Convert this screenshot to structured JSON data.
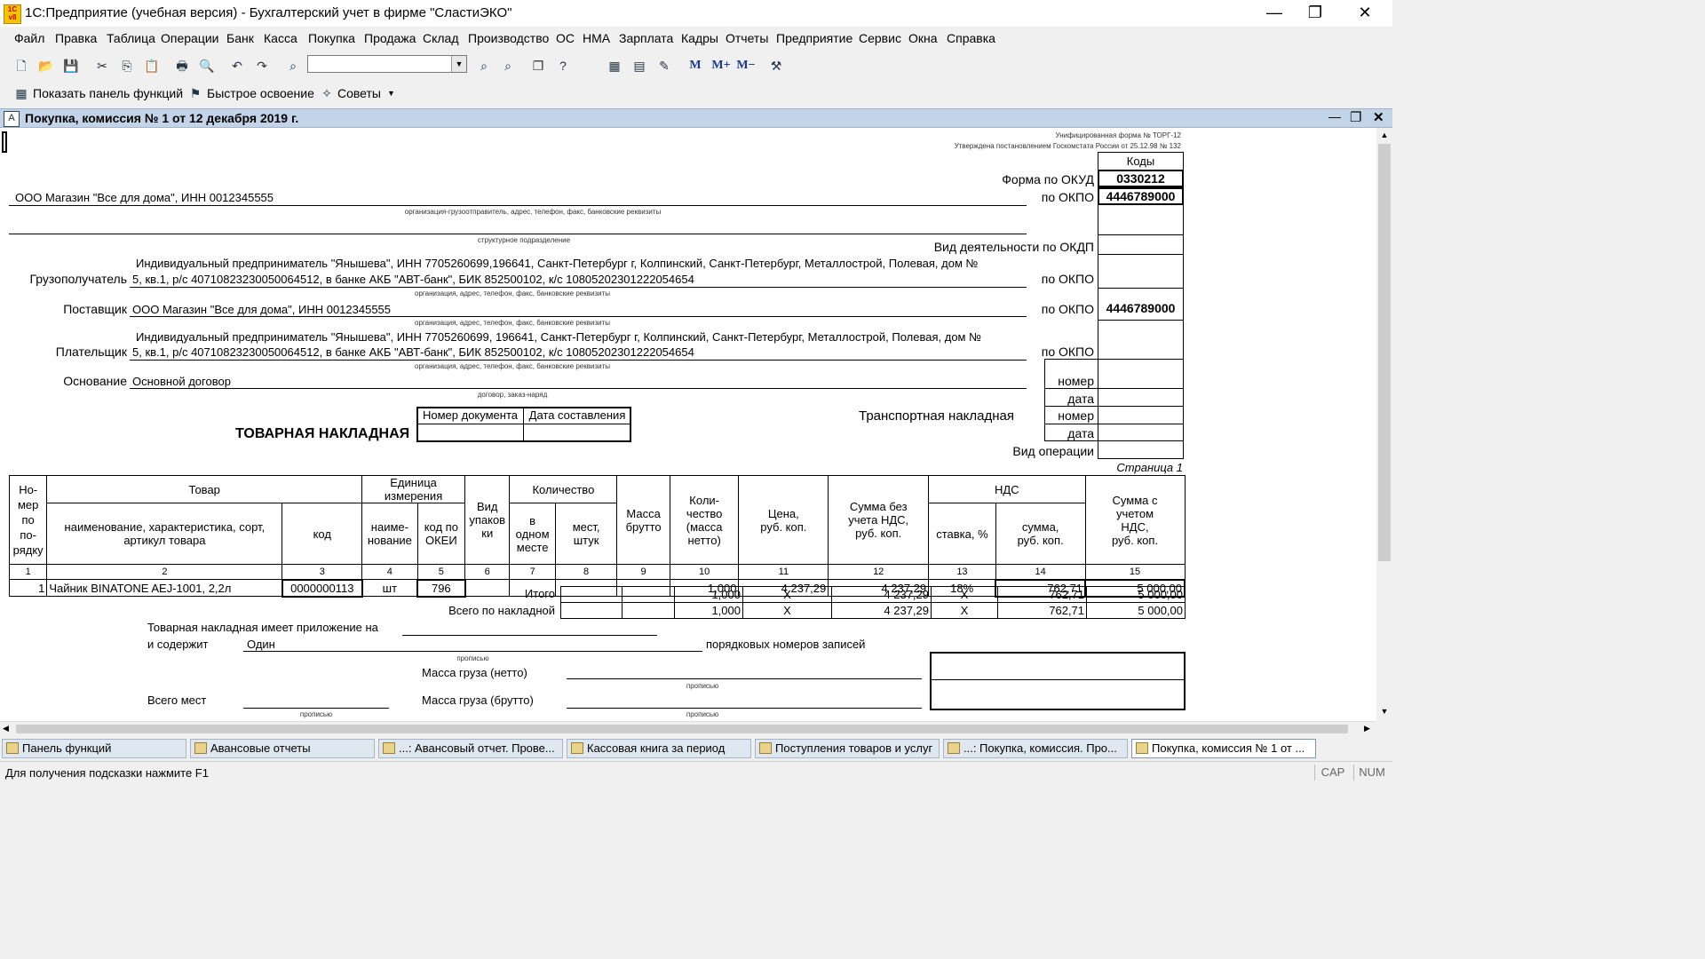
{
  "window": {
    "title": "1С:Предприятие (учебная версия) - Бухгалтерский учет в фирме \"СластиЭКО\"",
    "logo_text": "1С\nv8",
    "minimize": "—",
    "restore": "❐",
    "close": "✕"
  },
  "menu": [
    "Файл",
    "Правка",
    "Таблица",
    "Операции",
    "Банк",
    "Касса",
    "Покупка",
    "Продажа",
    "Склад",
    "Производство",
    "ОС",
    "НМА",
    "Зарплата",
    "Кадры",
    "Отчеты",
    "Предприятие",
    "Сервис",
    "Окна",
    "Справка"
  ],
  "toolbar2": {
    "functions_panel": "Показать панель функций",
    "quick_start": "Быстрое освоение",
    "tips": "Советы",
    "m_buttons": [
      "M",
      "M+",
      "M−"
    ]
  },
  "document_window": {
    "title": "Покупка, комиссия № 1 от 12 декабря 2019 г.",
    "minimize": "—",
    "restore": "❐",
    "close": "✕"
  },
  "form": {
    "unified_form": "Унифицированная форма № ТОРГ-12",
    "approved": "Утверждена постановлением Госкомстата России от 25.12.98 № 132",
    "codes_header": "Коды",
    "okud_label": "Форма по ОКУД",
    "okud_value": "0330212",
    "okpo_label": "по ОКПО",
    "okpo_value_1": "4446789000",
    "okpo_value_2": "4446789000",
    "okdp_label": "Вид деятельности по ОКДП",
    "shipper": "ООО Магазин \"Все для дома\", ИНН 0012345555",
    "shipper_caption": "организация-грузоотправитель, адрес, телефон, факс, банковские реквизиты",
    "division_caption": "структурное подразделение",
    "consignee_label": "Грузополучатель",
    "consignee_line1": "Индивидуальный предприниматель \"Янышева\", ИНН 7705260699,196641, Санкт-Петербург г, Колпинский, Санкт-Петербург, Металлострой, Полевая, дом №",
    "consignee_line2": "5, кв.1, р/с 40710823230050064512, в банке АКБ \"АВТ-банк\", БИК 852500102, к/с 10805202301222054654",
    "org_caption": "организация, адрес, телефон, факс, банковские реквизиты",
    "supplier_label": "Поставщик",
    "supplier": "ООО Магазин \"Все для дома\", ИНН 0012345555",
    "payer_label": "Плательщик",
    "payer_line1": "Индивидуальный предприниматель \"Янышева\", ИНН 7705260699, 196641, Санкт-Петербург г, Колпинский, Санкт-Петербург, Металлострой, Полевая, дом №",
    "payer_line2": "5, кв.1, р/с 40710823230050064512, в банке АКБ \"АВТ-банк\", БИК 852500102, к/с 10805202301222054654",
    "basis_label": "Основание",
    "basis": "Основной договор",
    "basis_caption": "договор, заказ-наряд",
    "number_label": "номер",
    "date_label": "дата",
    "transport_label": "Транспортная накладная",
    "operation_label": "Вид операции",
    "doc_number_header": "Номер документа",
    "doc_date_header": "Дата составления",
    "doc_name": "ТОВАРНАЯ НАКЛАДНАЯ",
    "page_label": "Страница 1"
  },
  "table": {
    "h_num": "Но-\nмер\nпо\nпо-\nрядку",
    "h_goods": "Товар",
    "h_goods_name": "наименование, характеристика, сорт, артикул товара",
    "h_code": "код",
    "h_unit": "Единица измерения",
    "h_unit_name": "наиме-\nнование",
    "h_okei": "код по\nОКЕИ",
    "h_pack": "Вид\nупаков\nки",
    "h_qty": "Количество",
    "h_qty_one": "в\nодном\nместе",
    "h_places": "мест,\nштук",
    "h_gross": "Масса\nбрутто",
    "h_net": "Коли-\nчество\n(масса\nнетто)",
    "h_price": "Цена,\nруб. коп.",
    "h_sum_novat": "Сумма без\nучета НДС,\nруб. коп.",
    "h_vat": "НДС",
    "h_vat_rate": "ставка, %",
    "h_vat_sum": "сумма,\nруб. коп.",
    "h_sum_vat": "Сумма с\nучетом\nНДС,\nруб. коп.",
    "col_numbers": [
      "1",
      "2",
      "3",
      "4",
      "5",
      "6",
      "7",
      "8",
      "9",
      "10",
      "11",
      "12",
      "13",
      "14",
      "15"
    ],
    "rows": [
      {
        "num": "1",
        "name": "Чайник BINATONE  AEJ-1001,  2,2л",
        "code": "0000000113",
        "unit": "шт",
        "okei": "796",
        "pack": "",
        "qty_one": "",
        "places": "",
        "gross": "",
        "net": "1,000",
        "price": "4 237,29",
        "sum": "4 237,29",
        "rate": "18%",
        "vat": "762,71",
        "total": "5 000,00"
      }
    ],
    "itogo_label": "Итого",
    "itogo": {
      "net": "1,000",
      "price": "X",
      "sum": "4 237,29",
      "rate": "X",
      "vat": "762,71",
      "total": "5 000,00"
    },
    "vsego_label": "Всего по накладной",
    "vsego": {
      "net": "1,000",
      "price": "X",
      "sum": "4 237,29",
      "rate": "X",
      "vat": "762,71",
      "total": "5 000,00"
    }
  },
  "footer": {
    "attachment_label": "Товарная накладная имеет приложение на",
    "contains_label": "и содержит",
    "contains_value": "Один",
    "records_label": "порядковых номеров записей",
    "in_words": "прописью",
    "net_mass_label": "Масса груза (нетто)",
    "places_label": "Всего мест",
    "gross_mass_label": "Масса груза (брутто)"
  },
  "taskbar": [
    "Панель функций",
    "Авансовые отчеты",
    "...: Авансовый отчет. Прове...",
    "Кассовая книга за период",
    "Поступления товаров и услуг",
    "...: Покупка, комиссия. Про...",
    "Покупка, комиссия № 1 от ..."
  ],
  "status": {
    "hint": "Для получения подсказки нажмите F1",
    "cap": "CAP",
    "num": "NUM"
  }
}
